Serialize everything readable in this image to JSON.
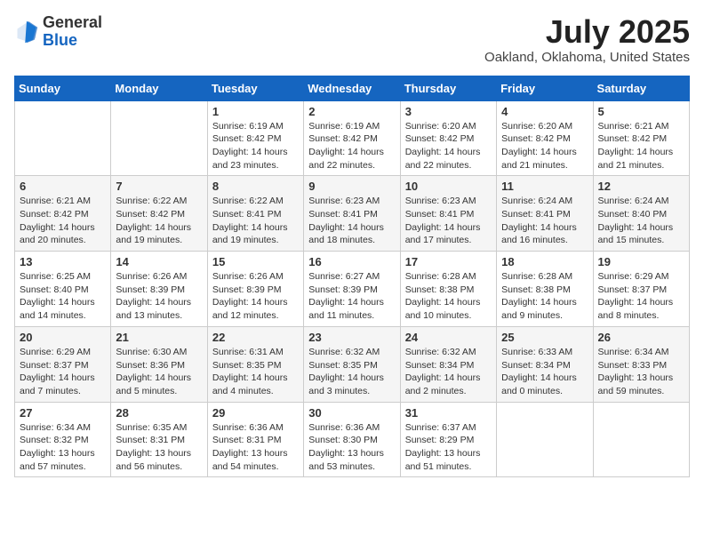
{
  "logo": {
    "general": "General",
    "blue": "Blue"
  },
  "header": {
    "month": "July 2025",
    "location": "Oakland, Oklahoma, United States"
  },
  "weekdays": [
    "Sunday",
    "Monday",
    "Tuesday",
    "Wednesday",
    "Thursday",
    "Friday",
    "Saturday"
  ],
  "weeks": [
    [
      {
        "day": "",
        "info": ""
      },
      {
        "day": "",
        "info": ""
      },
      {
        "day": "1",
        "info": "Sunrise: 6:19 AM\nSunset: 8:42 PM\nDaylight: 14 hours and 23 minutes."
      },
      {
        "day": "2",
        "info": "Sunrise: 6:19 AM\nSunset: 8:42 PM\nDaylight: 14 hours and 22 minutes."
      },
      {
        "day": "3",
        "info": "Sunrise: 6:20 AM\nSunset: 8:42 PM\nDaylight: 14 hours and 22 minutes."
      },
      {
        "day": "4",
        "info": "Sunrise: 6:20 AM\nSunset: 8:42 PM\nDaylight: 14 hours and 21 minutes."
      },
      {
        "day": "5",
        "info": "Sunrise: 6:21 AM\nSunset: 8:42 PM\nDaylight: 14 hours and 21 minutes."
      }
    ],
    [
      {
        "day": "6",
        "info": "Sunrise: 6:21 AM\nSunset: 8:42 PM\nDaylight: 14 hours and 20 minutes."
      },
      {
        "day": "7",
        "info": "Sunrise: 6:22 AM\nSunset: 8:42 PM\nDaylight: 14 hours and 19 minutes."
      },
      {
        "day": "8",
        "info": "Sunrise: 6:22 AM\nSunset: 8:41 PM\nDaylight: 14 hours and 19 minutes."
      },
      {
        "day": "9",
        "info": "Sunrise: 6:23 AM\nSunset: 8:41 PM\nDaylight: 14 hours and 18 minutes."
      },
      {
        "day": "10",
        "info": "Sunrise: 6:23 AM\nSunset: 8:41 PM\nDaylight: 14 hours and 17 minutes."
      },
      {
        "day": "11",
        "info": "Sunrise: 6:24 AM\nSunset: 8:41 PM\nDaylight: 14 hours and 16 minutes."
      },
      {
        "day": "12",
        "info": "Sunrise: 6:24 AM\nSunset: 8:40 PM\nDaylight: 14 hours and 15 minutes."
      }
    ],
    [
      {
        "day": "13",
        "info": "Sunrise: 6:25 AM\nSunset: 8:40 PM\nDaylight: 14 hours and 14 minutes."
      },
      {
        "day": "14",
        "info": "Sunrise: 6:26 AM\nSunset: 8:39 PM\nDaylight: 14 hours and 13 minutes."
      },
      {
        "day": "15",
        "info": "Sunrise: 6:26 AM\nSunset: 8:39 PM\nDaylight: 14 hours and 12 minutes."
      },
      {
        "day": "16",
        "info": "Sunrise: 6:27 AM\nSunset: 8:39 PM\nDaylight: 14 hours and 11 minutes."
      },
      {
        "day": "17",
        "info": "Sunrise: 6:28 AM\nSunset: 8:38 PM\nDaylight: 14 hours and 10 minutes."
      },
      {
        "day": "18",
        "info": "Sunrise: 6:28 AM\nSunset: 8:38 PM\nDaylight: 14 hours and 9 minutes."
      },
      {
        "day": "19",
        "info": "Sunrise: 6:29 AM\nSunset: 8:37 PM\nDaylight: 14 hours and 8 minutes."
      }
    ],
    [
      {
        "day": "20",
        "info": "Sunrise: 6:29 AM\nSunset: 8:37 PM\nDaylight: 14 hours and 7 minutes."
      },
      {
        "day": "21",
        "info": "Sunrise: 6:30 AM\nSunset: 8:36 PM\nDaylight: 14 hours and 5 minutes."
      },
      {
        "day": "22",
        "info": "Sunrise: 6:31 AM\nSunset: 8:35 PM\nDaylight: 14 hours and 4 minutes."
      },
      {
        "day": "23",
        "info": "Sunrise: 6:32 AM\nSunset: 8:35 PM\nDaylight: 14 hours and 3 minutes."
      },
      {
        "day": "24",
        "info": "Sunrise: 6:32 AM\nSunset: 8:34 PM\nDaylight: 14 hours and 2 minutes."
      },
      {
        "day": "25",
        "info": "Sunrise: 6:33 AM\nSunset: 8:34 PM\nDaylight: 14 hours and 0 minutes."
      },
      {
        "day": "26",
        "info": "Sunrise: 6:34 AM\nSunset: 8:33 PM\nDaylight: 13 hours and 59 minutes."
      }
    ],
    [
      {
        "day": "27",
        "info": "Sunrise: 6:34 AM\nSunset: 8:32 PM\nDaylight: 13 hours and 57 minutes."
      },
      {
        "day": "28",
        "info": "Sunrise: 6:35 AM\nSunset: 8:31 PM\nDaylight: 13 hours and 56 minutes."
      },
      {
        "day": "29",
        "info": "Sunrise: 6:36 AM\nSunset: 8:31 PM\nDaylight: 13 hours and 54 minutes."
      },
      {
        "day": "30",
        "info": "Sunrise: 6:36 AM\nSunset: 8:30 PM\nDaylight: 13 hours and 53 minutes."
      },
      {
        "day": "31",
        "info": "Sunrise: 6:37 AM\nSunset: 8:29 PM\nDaylight: 13 hours and 51 minutes."
      },
      {
        "day": "",
        "info": ""
      },
      {
        "day": "",
        "info": ""
      }
    ]
  ]
}
